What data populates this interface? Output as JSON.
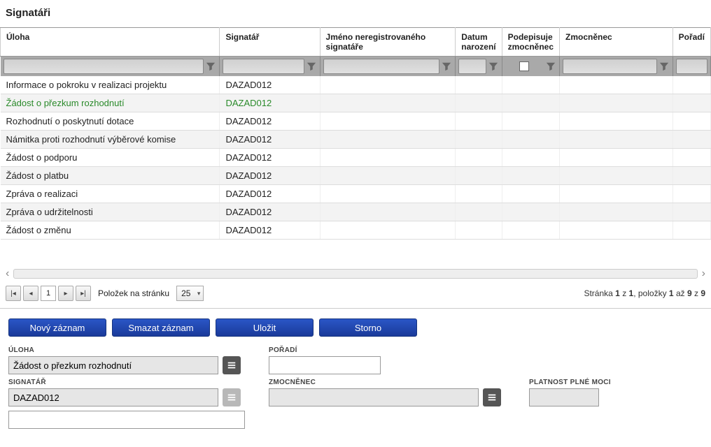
{
  "title": "Signatáři",
  "columns": {
    "uloha": "Úloha",
    "signatar": "Signatář",
    "jmeno": "Jméno neregistrovaného signatáře",
    "datum": "Datum narození",
    "podep": "Podepisuje zmocněnec",
    "zmoc": "Zmocněnec",
    "poradi": "Pořadí"
  },
  "rows": [
    {
      "uloha": "Informace o pokroku v realizaci projektu",
      "signatar": "DAZAD012",
      "selected": false
    },
    {
      "uloha": "Žádost o přezkum rozhodnutí",
      "signatar": "DAZAD012",
      "selected": true
    },
    {
      "uloha": "Rozhodnutí o poskytnutí dotace",
      "signatar": "DAZAD012",
      "selected": false
    },
    {
      "uloha": "Námitka proti rozhodnutí výběrové komise",
      "signatar": "DAZAD012",
      "selected": false
    },
    {
      "uloha": "Žádost o podporu",
      "signatar": "DAZAD012",
      "selected": false
    },
    {
      "uloha": "Žádost o platbu",
      "signatar": "DAZAD012",
      "selected": false
    },
    {
      "uloha": "Zpráva o realizaci",
      "signatar": "DAZAD012",
      "selected": false
    },
    {
      "uloha": "Zpráva o udržitelnosti",
      "signatar": "DAZAD012",
      "selected": false
    },
    {
      "uloha": "Žádost o změnu",
      "signatar": "DAZAD012",
      "selected": false
    }
  ],
  "pager": {
    "current": "1",
    "page_size_label": "Položek na stránku",
    "page_size": "25",
    "info_prefix": "Stránka ",
    "info_page": "1",
    "info_of": " z ",
    "info_pages": "1",
    "info_items": ", položky ",
    "info_from": "1",
    "info_to_word": " až ",
    "info_to": "9",
    "info_total_word": " z ",
    "info_total": "9"
  },
  "actions": {
    "new": "Nový záznam",
    "delete": "Smazat záznam",
    "save": "Uložit",
    "cancel": "Storno"
  },
  "form": {
    "uloha_label": "ÚLOHA",
    "uloha_value": "Žádost o přezkum rozhodnutí",
    "poradi_label": "POŘADÍ",
    "poradi_value": "",
    "signatar_label": "SIGNATÁŘ",
    "signatar_value": "DAZAD012",
    "signatar_extra": "",
    "zmocnenec_label": "ZMOCNĚNEC",
    "zmocnenec_value": "",
    "platnost_label": "PLATNOST PLNÉ MOCI",
    "platnost_value": ""
  }
}
